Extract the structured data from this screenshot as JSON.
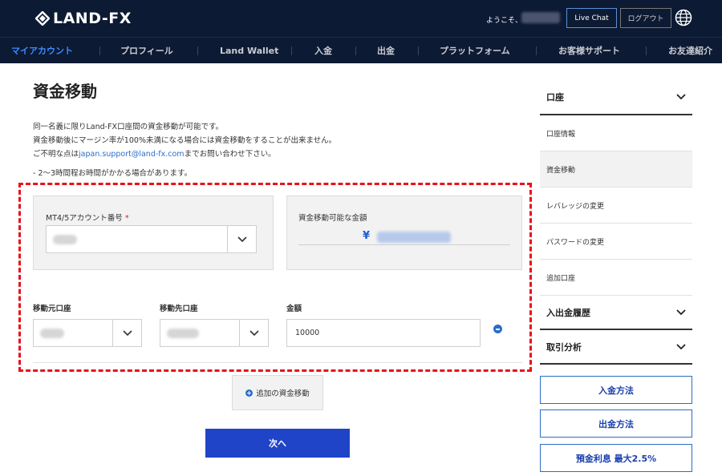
{
  "header": {
    "logo_text": "LAND-FX",
    "welcome": "ようこそ、",
    "live_chat": "Live Chat",
    "logout": "ログアウト"
  },
  "nav": {
    "items": [
      {
        "label": "マイアカウント",
        "active": true
      },
      {
        "label": "プロフィール"
      },
      {
        "label": "Land Wallet"
      },
      {
        "label": "入金"
      },
      {
        "label": "出金"
      },
      {
        "label": "プラットフォーム"
      },
      {
        "label": "お客様サポート"
      },
      {
        "label": "お友達紹介"
      }
    ]
  },
  "main": {
    "title": "資金移動",
    "desc_line1": "同一名義に限りLand-FX口座間の資金移動が可能です。",
    "desc_line2": "資金移動後にマージン率が100%未満になる場合には資金移動をすることが出来ません。",
    "desc_line3_prefix": "ご不明な点は",
    "desc_line3_email": "japan.support@land-fx.com",
    "desc_line3_suffix": "までお問い合わせ下さい。",
    "note": "- 2〜3時間程お時間がかかる場合があります。",
    "account_label": "MT4/5アカウント番号",
    "required_mark": "*",
    "available_label": "資金移動可能な金額",
    "yen_symbol": "¥",
    "from_label": "移動元口座",
    "to_label": "移動先口座",
    "amount_label": "金額",
    "amount_value": "10000",
    "add_transfer": "追加の資金移動",
    "next": "次へ"
  },
  "sidebar": {
    "section_account": "口座",
    "items": [
      {
        "label": "口座情報"
      },
      {
        "label": "資金移動",
        "active": true
      },
      {
        "label": "レバレッジの変更"
      },
      {
        "label": "パスワードの変更"
      },
      {
        "label": "追加口座"
      }
    ],
    "section_history": "入出金履歴",
    "section_analysis": "取引分析",
    "btn_deposit": "入金方法",
    "btn_withdraw": "出金方法",
    "btn_interest": "預金利息 最大2.5%"
  },
  "colors": {
    "header_bg": "#0d1a33",
    "nav_active": "#3b8cff",
    "primary_button": "#1f44c7",
    "dashed_outline": "#e8121c",
    "link": "#2a6ec8"
  }
}
